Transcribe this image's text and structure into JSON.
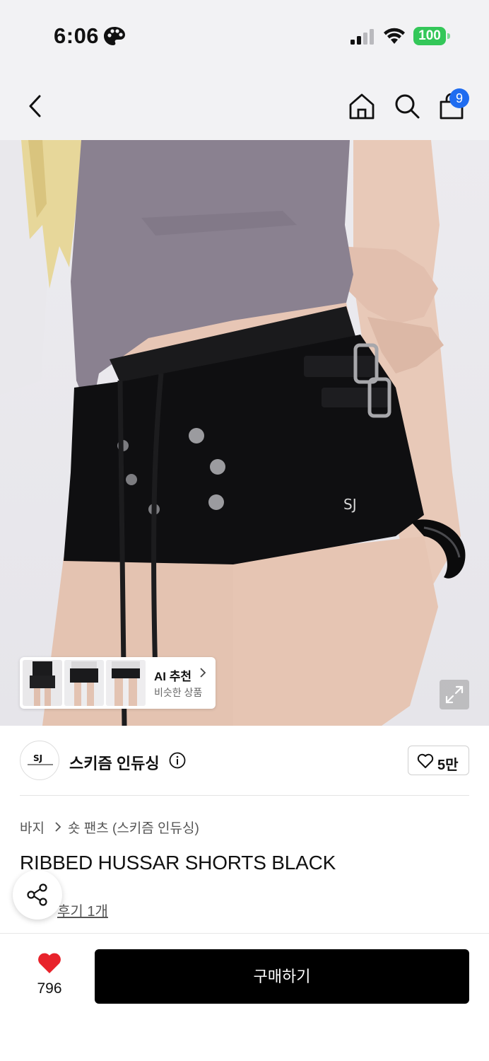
{
  "status_bar": {
    "time": "6:06",
    "battery": "100"
  },
  "nav": {
    "cart_count": "9"
  },
  "ai_recommend": {
    "title": "AI 추천",
    "subtitle": "비슷한 상품"
  },
  "brand": {
    "name": "스키즘 인듀싱",
    "likes": "5만"
  },
  "breadcrumb": {
    "category": "바지",
    "subcategory": "숏 팬츠 (스키즘 인듀싱)"
  },
  "product": {
    "title": "RIBBED HUSSAR SHORTS BLACK",
    "review_link": "후기 1개"
  },
  "bottom_bar": {
    "wish_count": "796",
    "buy_label": "구매하기"
  },
  "colors": {
    "accent_blue": "#1f6cf0",
    "battery_green": "#34c759",
    "heart_red": "#e8232b",
    "buy_button": "#000000"
  },
  "icons": [
    "palette-icon",
    "signal-icon",
    "wifi-icon",
    "back-icon",
    "home-icon",
    "search-icon",
    "shopping-bag-icon",
    "expand-icon",
    "info-icon",
    "heart-outline-icon",
    "chevron-right-icon",
    "share-icon",
    "heart-filled-icon"
  ]
}
